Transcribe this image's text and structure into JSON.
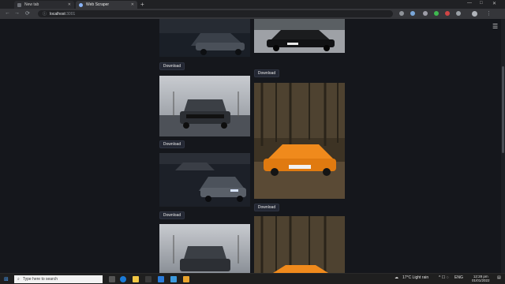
{
  "browser": {
    "tabs": [
      {
        "title": "New tab"
      },
      {
        "title": "Web Scraper"
      }
    ],
    "new_tab_symbol": "+",
    "window_controls": [
      "—",
      "□",
      "✕"
    ],
    "url_host": "localhost",
    "url_port": ":3001",
    "nav_icons": [
      "←",
      "→",
      "⟳",
      "ⓘ"
    ]
  },
  "page": {
    "menu_icon": "☰",
    "download_label": "Download"
  },
  "taskbar": {
    "search_placeholder": "Type here to search",
    "weather": "17°C Light rain",
    "language": "ENG",
    "time": "12:28 pm",
    "date": "01/01/2022"
  },
  "colors": {
    "accent": "#4aa3ff",
    "page_bg": "#15171c",
    "button_bg": "#232733"
  }
}
